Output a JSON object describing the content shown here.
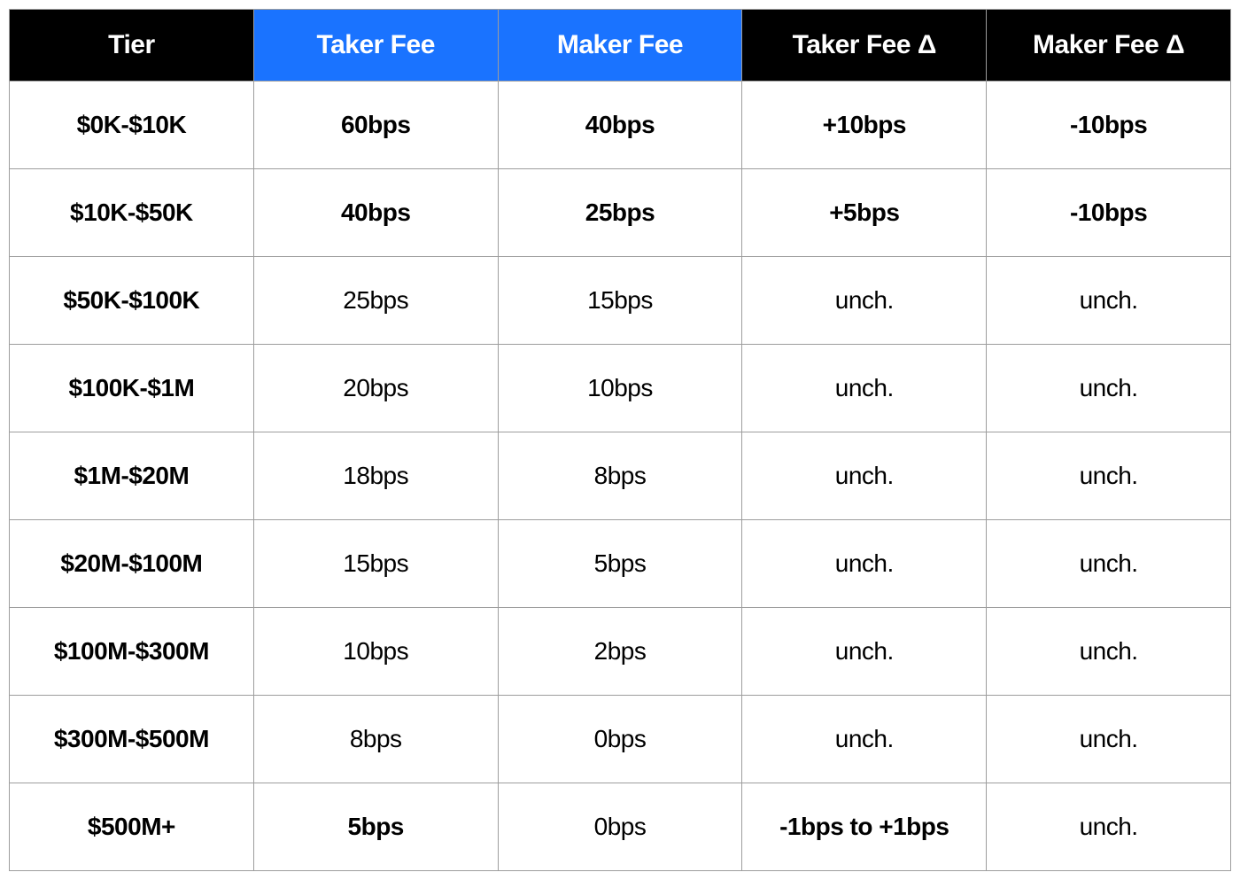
{
  "columns": [
    {
      "label": "Tier",
      "style": "black"
    },
    {
      "label": "Taker Fee",
      "style": "blue"
    },
    {
      "label": "Maker Fee",
      "style": "blue"
    },
    {
      "label": "Taker Fee Δ",
      "style": "black"
    },
    {
      "label": "Maker Fee Δ",
      "style": "black"
    }
  ],
  "rows": [
    {
      "tier": "$0K-$10K",
      "cells": [
        {
          "text": "60bps",
          "bold": true
        },
        {
          "text": "40bps",
          "bold": true
        },
        {
          "text": "+10bps",
          "bold": true
        },
        {
          "text": "-10bps",
          "bold": true
        }
      ]
    },
    {
      "tier": "$10K-$50K",
      "cells": [
        {
          "text": "40bps",
          "bold": true
        },
        {
          "text": "25bps",
          "bold": true
        },
        {
          "text": "+5bps",
          "bold": true
        },
        {
          "text": "-10bps",
          "bold": true
        }
      ]
    },
    {
      "tier": "$50K-$100K",
      "cells": [
        {
          "text": "25bps",
          "bold": false
        },
        {
          "text": "15bps",
          "bold": false
        },
        {
          "text": "unch.",
          "bold": false
        },
        {
          "text": "unch.",
          "bold": false
        }
      ]
    },
    {
      "tier": "$100K-$1M",
      "cells": [
        {
          "text": "20bps",
          "bold": false
        },
        {
          "text": "10bps",
          "bold": false
        },
        {
          "text": "unch.",
          "bold": false
        },
        {
          "text": "unch.",
          "bold": false
        }
      ]
    },
    {
      "tier": "$1M-$20M",
      "cells": [
        {
          "text": "18bps",
          "bold": false
        },
        {
          "text": "8bps",
          "bold": false
        },
        {
          "text": "unch.",
          "bold": false
        },
        {
          "text": "unch.",
          "bold": false
        }
      ]
    },
    {
      "tier": "$20M-$100M",
      "cells": [
        {
          "text": "15bps",
          "bold": false
        },
        {
          "text": "5bps",
          "bold": false
        },
        {
          "text": "unch.",
          "bold": false
        },
        {
          "text": "unch.",
          "bold": false
        }
      ]
    },
    {
      "tier": "$100M-$300M",
      "cells": [
        {
          "text": "10bps",
          "bold": false
        },
        {
          "text": "2bps",
          "bold": false
        },
        {
          "text": "unch.",
          "bold": false
        },
        {
          "text": "unch.",
          "bold": false
        }
      ]
    },
    {
      "tier": "$300M-$500M",
      "cells": [
        {
          "text": "8bps",
          "bold": false
        },
        {
          "text": "0bps",
          "bold": false
        },
        {
          "text": "unch.",
          "bold": false
        },
        {
          "text": "unch.",
          "bold": false
        }
      ]
    },
    {
      "tier": "$500M+",
      "cells": [
        {
          "text": "5bps",
          "bold": true
        },
        {
          "text": "0bps",
          "bold": false
        },
        {
          "text": "-1bps to +1bps",
          "bold": true
        },
        {
          "text": "unch.",
          "bold": false
        }
      ]
    }
  ]
}
